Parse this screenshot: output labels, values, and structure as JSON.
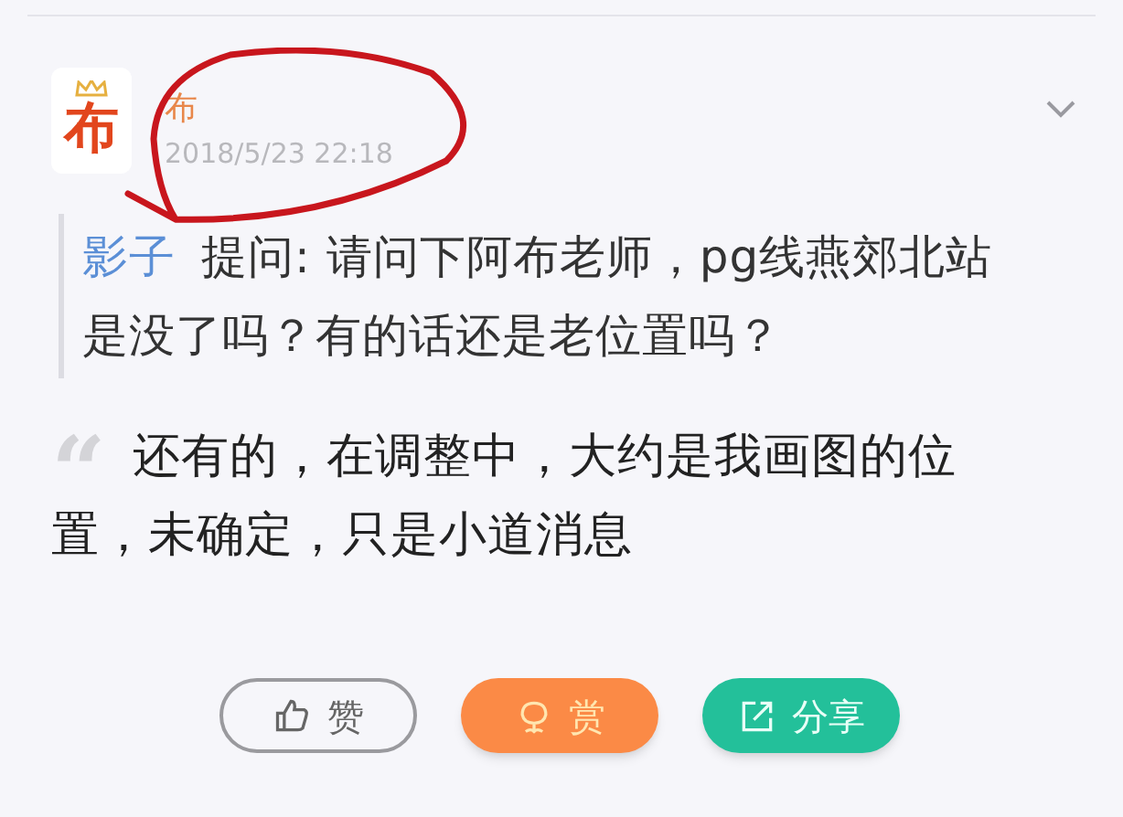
{
  "post": {
    "avatar_text": "布",
    "author": "布",
    "time": "2018/5/23 22:18"
  },
  "question": {
    "asker": "影子",
    "text": "提问: 请问下阿布老师，pg线燕郊北站是没了吗？有的话还是老位置吗？"
  },
  "quote_mark": "“",
  "answer": "还有的，在调整中，大约是我画图的位置，未确定，只是小道消息",
  "buttons": [
    {
      "kind": "like",
      "label": "赞"
    },
    {
      "kind": "reward",
      "label": "赏"
    },
    {
      "kind": "share",
      "label": "分享"
    }
  ]
}
